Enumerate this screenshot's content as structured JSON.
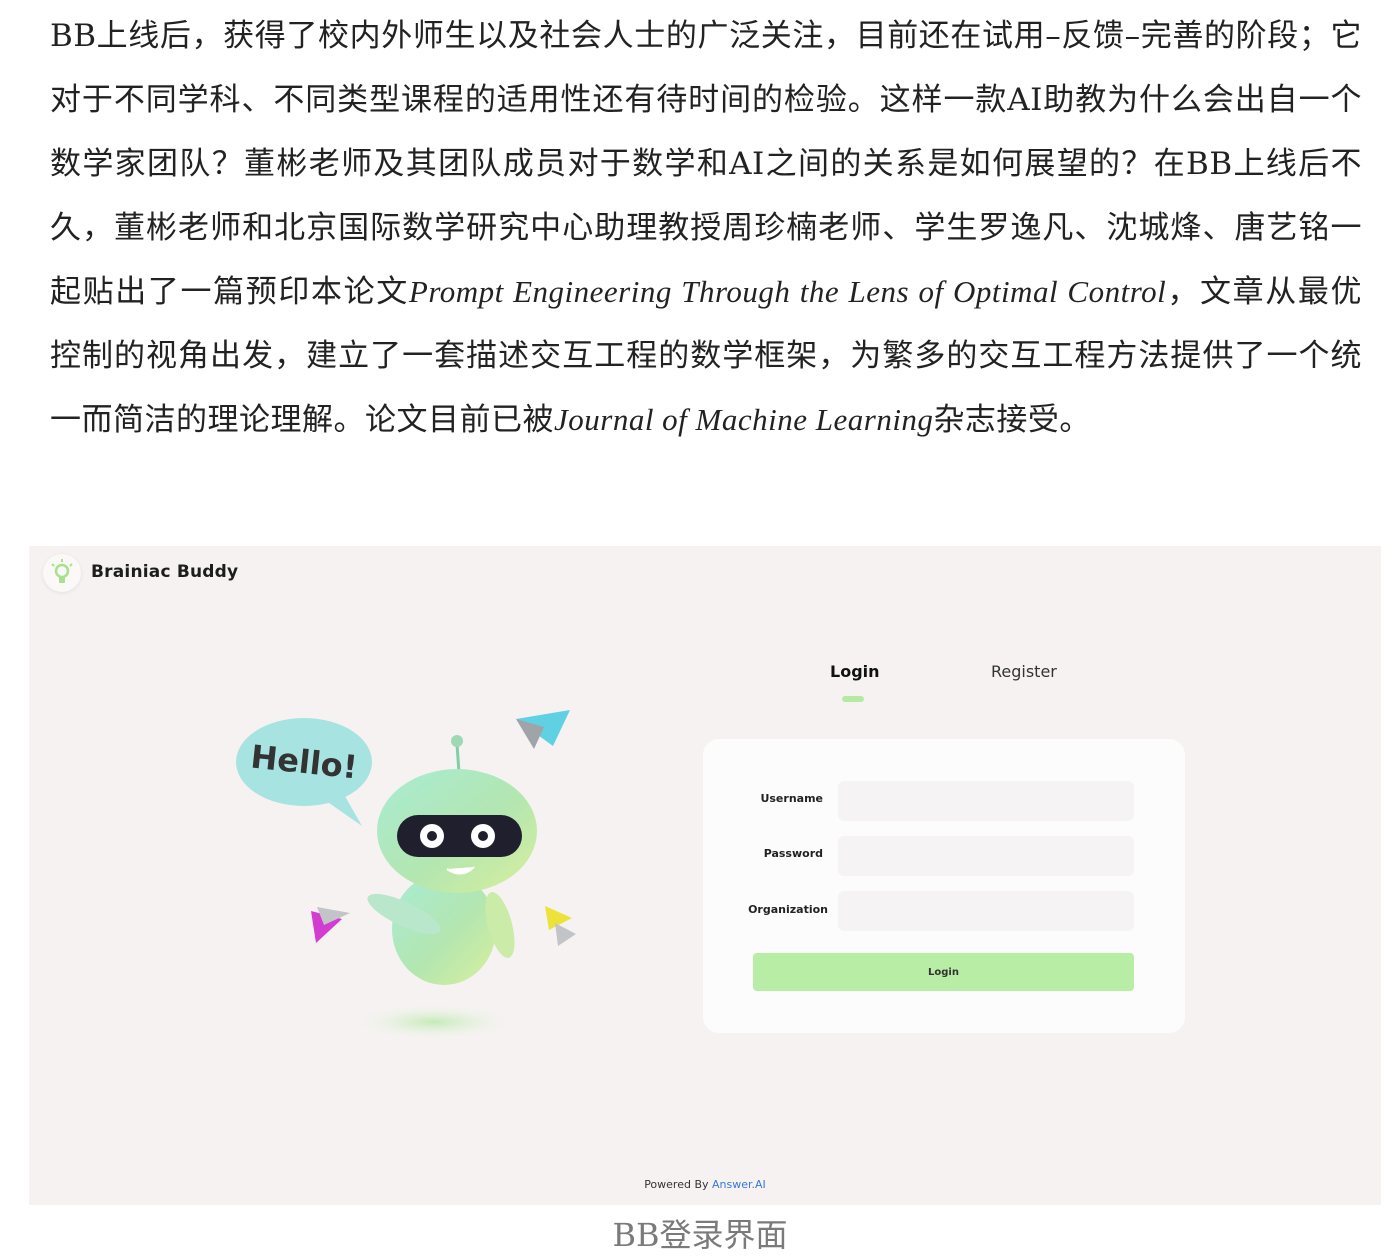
{
  "article": {
    "p1": "BB上线后，获得了校内外师生以及社会人士的广泛关注，目前还在试用–反馈–完善的阶段；它对于不同学科、不同类型课程的适用性还有待时间的检验。这样一款AI助教为什么会出自一个数学家团队？董彬老师及其团队成员对于数学和AI之间的关系是如何展望的？在BB上线后不久，董彬老师和北京国际数学研究中心助理教授周珍楠老师、学生罗逸凡、沈城烽、唐艺铭一起贴出了一篇预印本论文",
    "paper_title": "Prompt Engineering Through the Lens of Optimal Control",
    "p2": "，文章从最优控制的视角出发，建立了一套描述交互工程的数学框架，为繁多的交互工程方法提供了一个统一而简洁的理论理解。论文目前已被",
    "journal": "Journal of Machine Learning",
    "p3": "杂志接受。"
  },
  "app": {
    "brand": "Brainiac Buddy",
    "tabs": {
      "login": "Login",
      "register": "Register"
    },
    "form": {
      "username_label": "Username",
      "password_label": "Password",
      "organization_label": "Organization",
      "login_button": "Login"
    },
    "mascot": {
      "speech": "Hello!"
    },
    "footer": {
      "powered_by": "Powered By ",
      "provider": "Answer.AI"
    },
    "colors": {
      "accent": "#b8eda5",
      "background": "#f6f2f2",
      "link": "#3a78d8"
    }
  },
  "caption": "BB登录界面"
}
